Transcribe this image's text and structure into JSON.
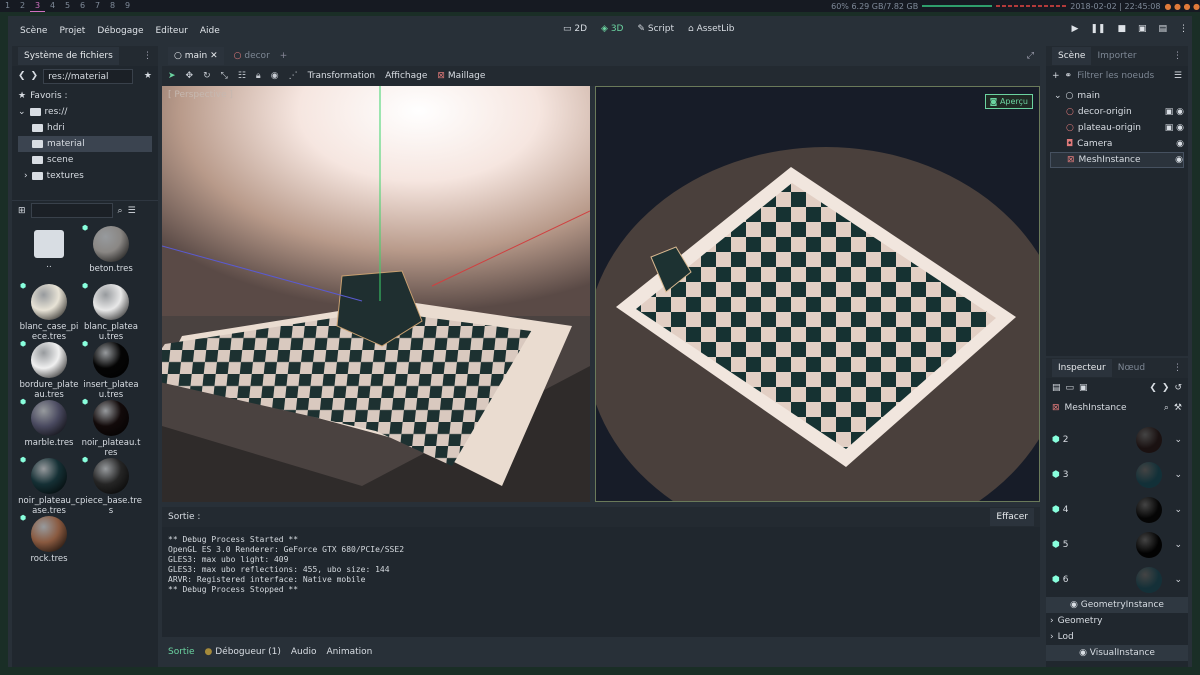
{
  "sysbar": {
    "workspaces": [
      "1",
      "2",
      "3",
      "4",
      "5",
      "6",
      "7",
      "8",
      "9"
    ],
    "active_workspace": "3",
    "memory": "60% 6.29 GB/7.82 GB",
    "datetime": "2018-02-02 | 22:45:08"
  },
  "menu": [
    "Scène",
    "Projet",
    "Débogage",
    "Editeur",
    "Aide"
  ],
  "modes": [
    "2D",
    "3D",
    "Script",
    "AssetLib"
  ],
  "active_mode": "3D",
  "filesystem": {
    "title": "Système de fichiers",
    "path": "res://material",
    "tree": [
      {
        "label": "Favoris :"
      },
      {
        "label": "res://"
      },
      {
        "label": "hdri"
      },
      {
        "label": "material"
      },
      {
        "label": "scene"
      },
      {
        "label": "textures"
      }
    ],
    "files": [
      {
        "name": ".."
      },
      {
        "name": "beton.tres"
      },
      {
        "name": "blanc_case_piece.tres"
      },
      {
        "name": "blanc_plateau.tres"
      },
      {
        "name": "bordure_plateau.tres"
      },
      {
        "name": "insert_plateau.tres"
      },
      {
        "name": "marble.tres"
      },
      {
        "name": "noir_plateau.tres"
      },
      {
        "name": "noir_plateau_case.tres"
      },
      {
        "name": "piece_base.tres"
      },
      {
        "name": "rock.tres"
      }
    ]
  },
  "editor_tabs": [
    "main",
    "decor"
  ],
  "viewport_toolbar": [
    "Transformation",
    "Affichage",
    "Maillage"
  ],
  "viewport": {
    "left_label": "[ Perspective ]",
    "preview_button": "Aperçu"
  },
  "output": {
    "title": "Sortie :",
    "clear_button": "Effacer",
    "lines": [
      "** Debug Process Started **",
      "OpenGL ES 3.0 Renderer: GeForce GTX 680/PCIe/SSE2",
      "GLES3: max ubo light: 409",
      "GLES3: max ubo reflections: 455, ubo size: 144",
      "ARVR: Registered interface: Native mobile",
      "** Debug Process Stopped **"
    ]
  },
  "bottom_tabs": [
    "Sortie",
    "Débogueur (1)",
    "Audio",
    "Animation"
  ],
  "scene": {
    "tabs": [
      "Scène",
      "Importer"
    ],
    "filter_placeholder": "Filtrer les noeuds",
    "nodes": [
      "main",
      "decor-origin",
      "plateau-origin",
      "Camera",
      "MeshInstance"
    ]
  },
  "inspector": {
    "tabs": [
      "Inspecteur",
      "Nœud"
    ],
    "object": "MeshInstance",
    "materials": [
      "2",
      "3",
      "4",
      "5",
      "6"
    ],
    "section1": "GeometryInstance",
    "props": [
      "Geometry",
      "Lod"
    ],
    "section2": "VisualInstance"
  },
  "colors": {
    "accent": "#6bd3a0",
    "selection": "#3b4450"
  }
}
